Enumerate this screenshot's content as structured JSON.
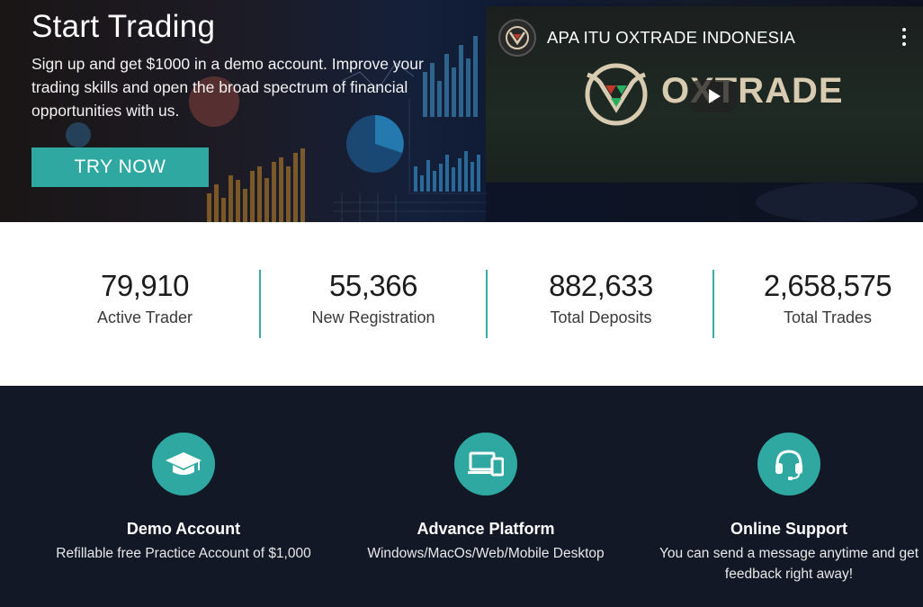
{
  "hero": {
    "title": "Start Trading",
    "subtitle": "Sign up and get $1000 in a demo account. Improve your trading skills and open the broad spectrum of financial opportunities with us.",
    "cta_label": "TRY NOW"
  },
  "video": {
    "title": "APA ITU OXTRADE INDONESIA",
    "logo_text": "OXTRADE",
    "channel_icon": "oxtrade-logo-icon",
    "menu_icon": "more-vert-icon",
    "play_icon": "play-icon"
  },
  "stats": [
    {
      "value": "79,910",
      "label": "Active Trader"
    },
    {
      "value": "55,366",
      "label": "New Registration"
    },
    {
      "value": "882,633",
      "label": "Total Deposits"
    },
    {
      "value": "2,658,575",
      "label": "Total Trades"
    }
  ],
  "features": [
    {
      "icon": "graduation-cap-icon",
      "title": "Demo Account",
      "description": "Refillable free Practice Account of $1,000"
    },
    {
      "icon": "devices-icon",
      "title": "Advance Platform",
      "description": "Windows/MacOs/Web/Mobile Desktop"
    },
    {
      "icon": "headset-icon",
      "title": "Online Support",
      "description": "You can send a message anytime and get feedback right away!"
    }
  ],
  "colors": {
    "accent": "#2fa8a2",
    "dark_bg": "#121826",
    "stats_bg": "#ffffff"
  }
}
